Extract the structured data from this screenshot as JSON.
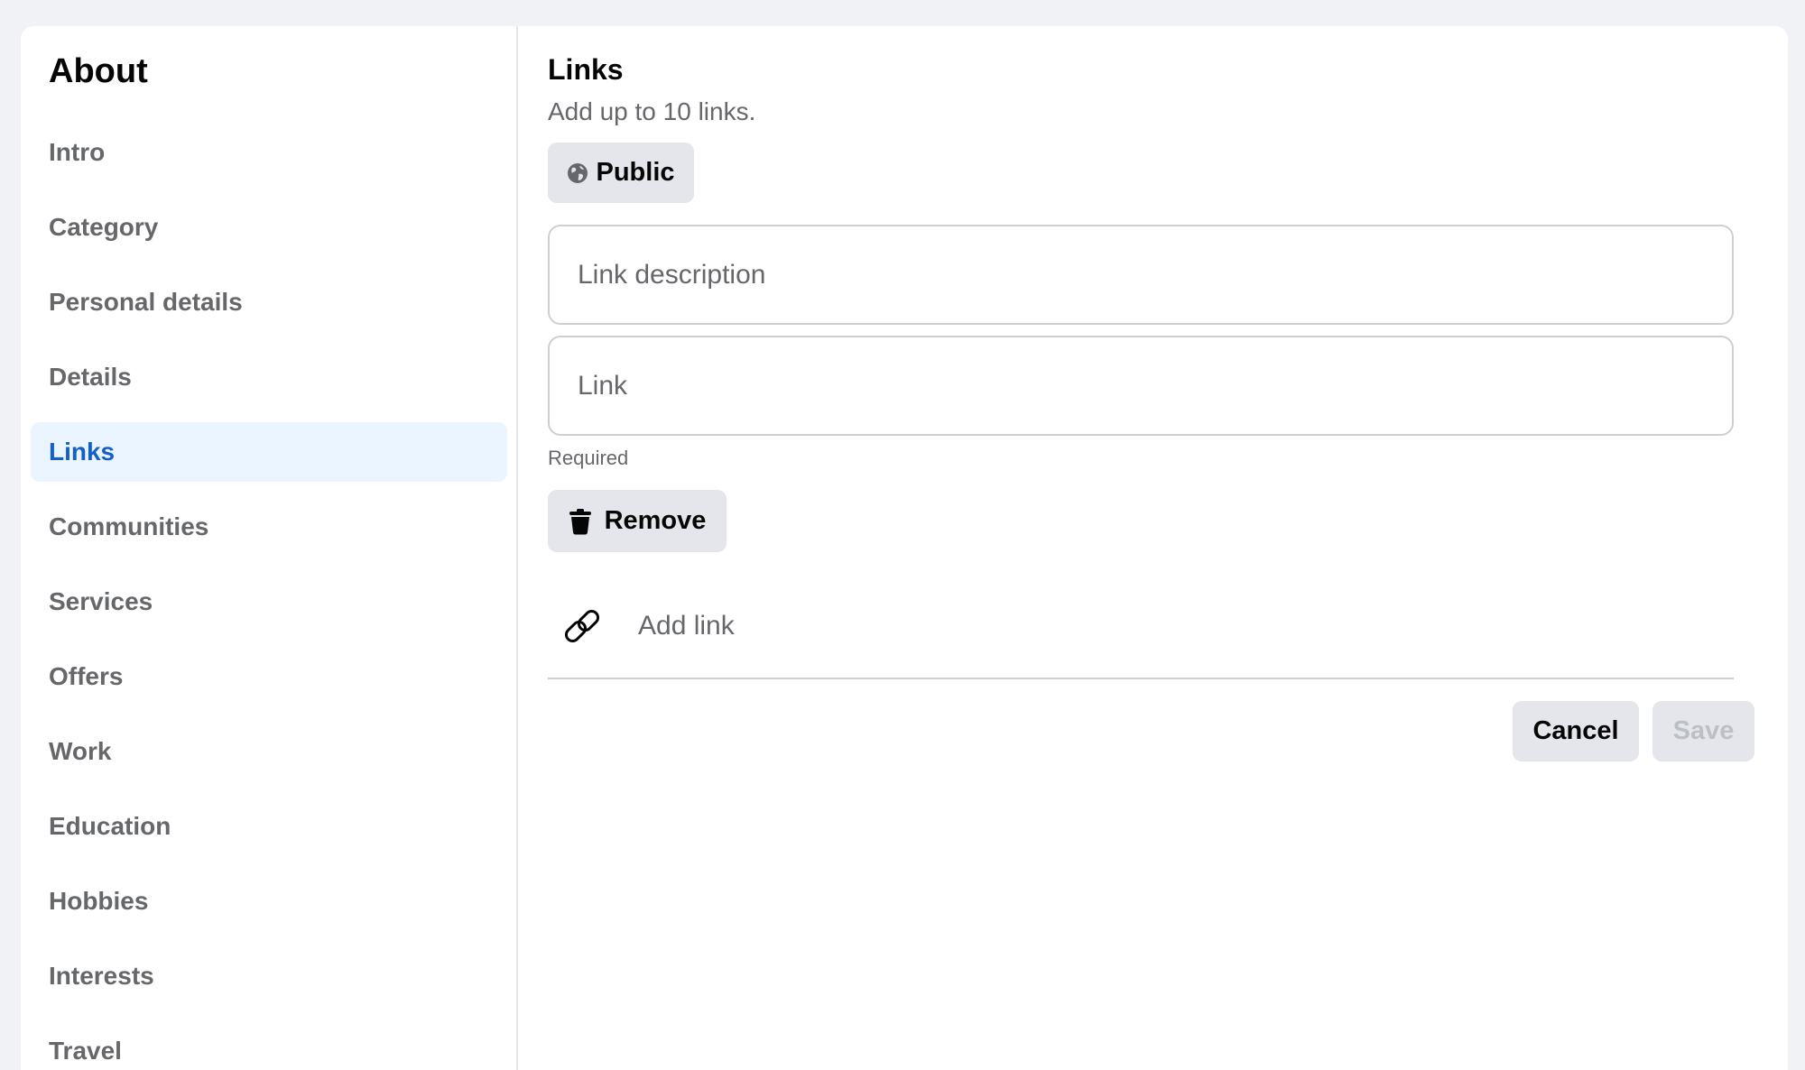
{
  "sidebar": {
    "title": "About",
    "items": [
      {
        "label": "Intro"
      },
      {
        "label": "Category"
      },
      {
        "label": "Personal details"
      },
      {
        "label": "Details"
      },
      {
        "label": "Links",
        "active": true
      },
      {
        "label": "Communities"
      },
      {
        "label": "Services"
      },
      {
        "label": "Offers"
      },
      {
        "label": "Work"
      },
      {
        "label": "Education"
      },
      {
        "label": "Hobbies"
      },
      {
        "label": "Interests"
      },
      {
        "label": "Travel"
      }
    ]
  },
  "main": {
    "title": "Links",
    "subtitle": "Add up to 10 links.",
    "privacy": {
      "label": "Public",
      "icon": "globe-icon"
    },
    "fields": {
      "description_placeholder": "Link description",
      "link_placeholder": "Link",
      "required_hint": "Required"
    },
    "remove": {
      "label": "Remove",
      "icon": "trash-icon"
    },
    "add_link": {
      "label": "Add link",
      "icon": "link-icon"
    },
    "actions": {
      "cancel_label": "Cancel",
      "save_label": "Save"
    }
  },
  "colors": {
    "accent": "#1360c6",
    "active_bg": "#ebf5ff",
    "button_bg": "#e4e6eb",
    "muted_text": "#65676b",
    "disabled_text": "#bcc0c4"
  }
}
